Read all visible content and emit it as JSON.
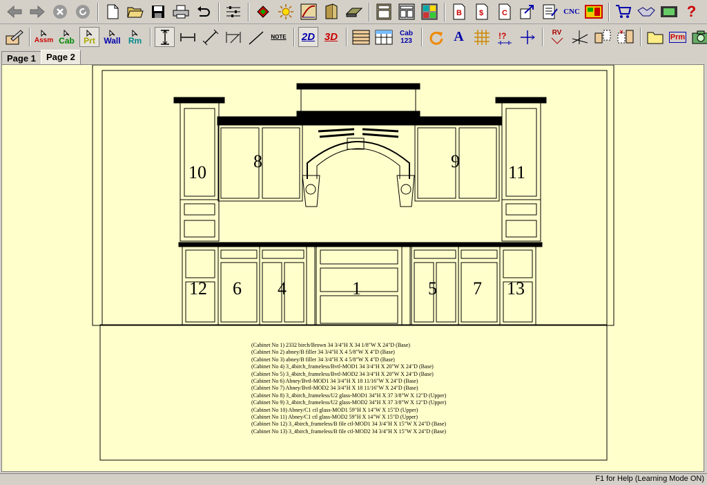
{
  "toolbar1": {
    "buttons": [
      {
        "name": "back-button",
        "icon": "arrow-left-icon"
      },
      {
        "name": "forward-button",
        "icon": "arrow-right-icon"
      },
      {
        "name": "stop-button",
        "icon": "stop-icon"
      },
      {
        "name": "refresh-button",
        "icon": "refresh-icon"
      },
      {
        "name": "new-button",
        "icon": "new-document-icon"
      },
      {
        "name": "open-button",
        "icon": "open-folder-icon"
      },
      {
        "name": "save-button",
        "icon": "save-icon"
      },
      {
        "name": "print-button",
        "icon": "printer-icon"
      },
      {
        "name": "undo-button",
        "icon": "undo-icon"
      },
      {
        "name": "properties-button",
        "icon": "sliders-icon"
      },
      {
        "name": "materials-button",
        "icon": "paint-bucket-icon"
      },
      {
        "name": "lighting-button",
        "icon": "sun-icon"
      },
      {
        "name": "pen-button",
        "icon": "pen-tool-icon"
      },
      {
        "name": "door-button",
        "icon": "door-icon"
      },
      {
        "name": "material-sheet-button",
        "icon": "sheet-icon"
      },
      {
        "name": "cabinet-list-button",
        "icon": "cabinet-icon"
      },
      {
        "name": "report-button",
        "icon": "report-icon"
      },
      {
        "name": "cutlist-button",
        "icon": "cutlist-icon"
      },
      {
        "name": "bid-button",
        "icon": "doc-b-icon"
      },
      {
        "name": "price-button",
        "icon": "doc-dollar-icon"
      },
      {
        "name": "c-report-button",
        "icon": "doc-c-icon"
      },
      {
        "name": "export-button",
        "icon": "export-icon"
      },
      {
        "name": "job-info-button",
        "icon": "checklist-icon"
      },
      {
        "name": "cnc-button",
        "label": "CNC"
      },
      {
        "name": "optimize-button",
        "icon": "panel-icon"
      },
      {
        "name": "order-button",
        "icon": "cart-icon"
      },
      {
        "name": "handshake-button",
        "icon": "handshake-icon"
      },
      {
        "name": "film-button",
        "icon": "film-icon"
      },
      {
        "name": "help-button",
        "label": "?"
      }
    ]
  },
  "toolbar2": {
    "buttons": [
      {
        "name": "edit-button",
        "icon": "edit-icon"
      },
      {
        "name": "assm-mode-button",
        "label": "Assm"
      },
      {
        "name": "cab-mode-button",
        "label": "Cab"
      },
      {
        "name": "prt-mode-button",
        "label": "Prt"
      },
      {
        "name": "wall-mode-button",
        "label": "Wall"
      },
      {
        "name": "rm-mode-button",
        "label": "Rm"
      },
      {
        "name": "dim-vertical-button",
        "icon": "dim-vertical-icon"
      },
      {
        "name": "dim-horizontal-button",
        "icon": "dim-horizontal-icon"
      },
      {
        "name": "dim-diagonal-button",
        "icon": "dim-diagonal-icon"
      },
      {
        "name": "dim-angle-button",
        "icon": "dim-angle-icon"
      },
      {
        "name": "line-button",
        "icon": "line-icon"
      },
      {
        "name": "note-button",
        "label": "NOTE"
      },
      {
        "name": "view-2d-button",
        "label": "2D"
      },
      {
        "name": "view-3d-button",
        "label": "3D"
      },
      {
        "name": "wall-layout-button",
        "icon": "layout-icon"
      },
      {
        "name": "elevation-button",
        "icon": "elevation-icon"
      },
      {
        "name": "cab-123-button",
        "label": "Cab 123"
      },
      {
        "name": "rotate-button",
        "icon": "rotate-icon"
      },
      {
        "name": "text-button",
        "label": "A"
      },
      {
        "name": "grid-button",
        "icon": "grid-icon"
      },
      {
        "name": "alert-button",
        "icon": "alert-icon"
      },
      {
        "name": "align-button",
        "icon": "align-icon"
      },
      {
        "name": "rv-button",
        "label": "RV"
      },
      {
        "name": "sightline-button",
        "icon": "sightline-icon"
      },
      {
        "name": "split-button",
        "icon": "split-icon"
      },
      {
        "name": "combine-button",
        "icon": "combine-icon"
      },
      {
        "name": "folder-button",
        "icon": "folder-icon"
      },
      {
        "name": "prm-button",
        "label": "Prm"
      },
      {
        "name": "camera-button",
        "icon": "camera-icon"
      }
    ]
  },
  "tabs": [
    {
      "label": "Page 1",
      "active": false
    },
    {
      "label": "Page 2",
      "active": true
    }
  ],
  "drawing": {
    "cabinet_numbers": [
      "10",
      "8",
      "9",
      "11",
      "12",
      "6",
      "4",
      "1",
      "5",
      "7",
      "13"
    ],
    "cabinet_list": [
      "(Cabinet No 1)  2332 birch/Brown  34 3/4\"H X 34 1/8\"W X 24\"D (Base)",
      "(Cabinet No 2)  abney/B filler  34 3/4\"H X 4 5/8\"W X 4\"D (Base)",
      "(Cabinet No 3)  abney/B filler  34 3/4\"H X 4 5/8\"W X 4\"D (Base)",
      "(Cabinet No 4)  3_4birch_frameless/Bvtl-MOD1  34 3/4\"H X 20\"W X 24\"D (Base)",
      "(Cabinet No 5)  3_4birch_frameless/Bvtl-MOD2  34 3/4\"H X 20\"W X 24\"D (Base)",
      "(Cabinet No 6)  Abney/Bvtl-MOD1  34 3/4\"H X 18 11/16\"W X 24\"D (Base)",
      "(Cabinet No 7)  Abney/Bvtl-MOD2  34 3/4\"H X 18 11/16\"W X 24\"D (Base)",
      "(Cabinet No 8)  3_4birch_frameless/U2 glass-MOD1  34\"H X 37 3/8\"W X 12\"D (Upper)",
      "(Cabinet No 9)  3_4birch_frameless/U2 glass-MOD2  34\"H X 37 3/8\"W X 12\"D (Upper)",
      "(Cabinet No 10)  Abney/C1 ctl glass-MOD1  59\"H X 14\"W X 15\"D (Upper)",
      "(Cabinet No 11)  Abney/C1 ctl glass-MOD2  59\"H X 14\"W X 15\"D (Upper)",
      "(Cabinet No 12)  3_4birch_frameless/B file ctl-MOD1  34 3/4\"H X 15\"W X 24\"D (Base)",
      "(Cabinet No 13)  3_4birch_frameless/B file ctl-MOD2  34 3/4\"H X 15\"W X 24\"D (Base)"
    ]
  },
  "status": {
    "help_text": "F1 for Help (Learning Mode ON)"
  }
}
